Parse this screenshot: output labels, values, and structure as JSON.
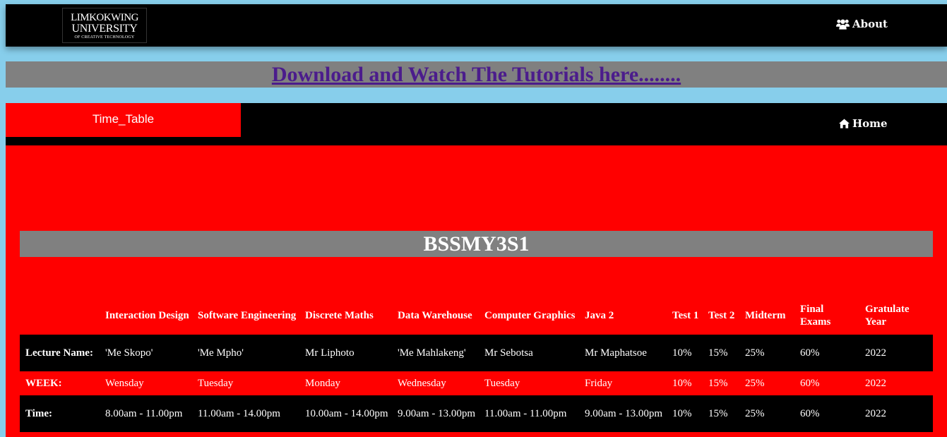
{
  "header": {
    "logo": {
      "line1": "LIMKOKWING",
      "line2": "UNIVERSITY",
      "line3": "OF CREATIVE TECHNOLOGY"
    },
    "about_label": "About",
    "about_icon": "users-icon"
  },
  "banner": {
    "link_text": "Download and Watch The Tutorials here........",
    "link_color": "#4b1c8c",
    "background": "#808080"
  },
  "nav": {
    "active_tab": "Time_Table",
    "home_label": "Home",
    "home_icon": "home-icon",
    "active_color": "#ff0000"
  },
  "timetable": {
    "title": "BSSMY3S1",
    "columns": [
      "",
      "Interaction Design",
      "Software Engineering",
      "Discrete Maths",
      "Data Warehouse",
      "Computer Graphics",
      "Java 2",
      "Test 1",
      "Test 2",
      "Midterm",
      "Final Exams",
      "Gratulate Year"
    ],
    "rows": [
      [
        "Lecture Name:",
        "'Me Skopo'",
        "'Me Mpho'",
        "Mr Liphoto",
        "'Me Mahlakeng'",
        "Mr Sebotsa",
        "Mr Maphatsoe",
        "10%",
        "15%",
        "25%",
        "60%",
        "2022"
      ],
      [
        "WEEK:",
        "Wensday",
        "Tuesday",
        "Monday",
        "Wednesday",
        "Tuesday",
        "Friday",
        "10%",
        "15%",
        "25%",
        "60%",
        "2022"
      ],
      [
        "Time:",
        "8.00am - 11.00pm",
        "11.00am - 14.00pm",
        "10.00am - 14.00pm",
        "9.00am - 13.00pm",
        "11.00am - 11.00pm",
        "9.00am - 13.00pm",
        "10%",
        "15%",
        "25%",
        "60%",
        "2022"
      ]
    ]
  },
  "colors": {
    "page_background": "#87ceeb",
    "bar_background": "#000000",
    "content_background": "#ff0000",
    "title_background": "#808080"
  }
}
